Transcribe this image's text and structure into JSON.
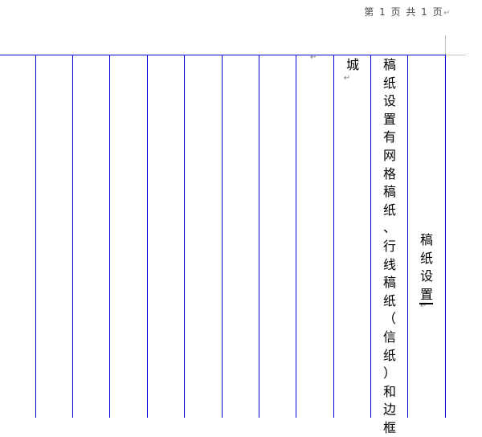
{
  "header": {
    "page_indicator": "第 1 页 共 1 页",
    "page_indicator_mark": "↵"
  },
  "columns": [
    {
      "text": "城",
      "mark": "↵"
    },
    {
      "text": "稿纸设置有网格稿纸、行线稿纸（信纸）和边框"
    },
    {
      "text": "稿纸设置",
      "mark": "↵"
    }
  ],
  "empty_cell_mark": "↵",
  "colors": {
    "grid_line": "#0000dd",
    "page_border": "#c4c4c4"
  }
}
